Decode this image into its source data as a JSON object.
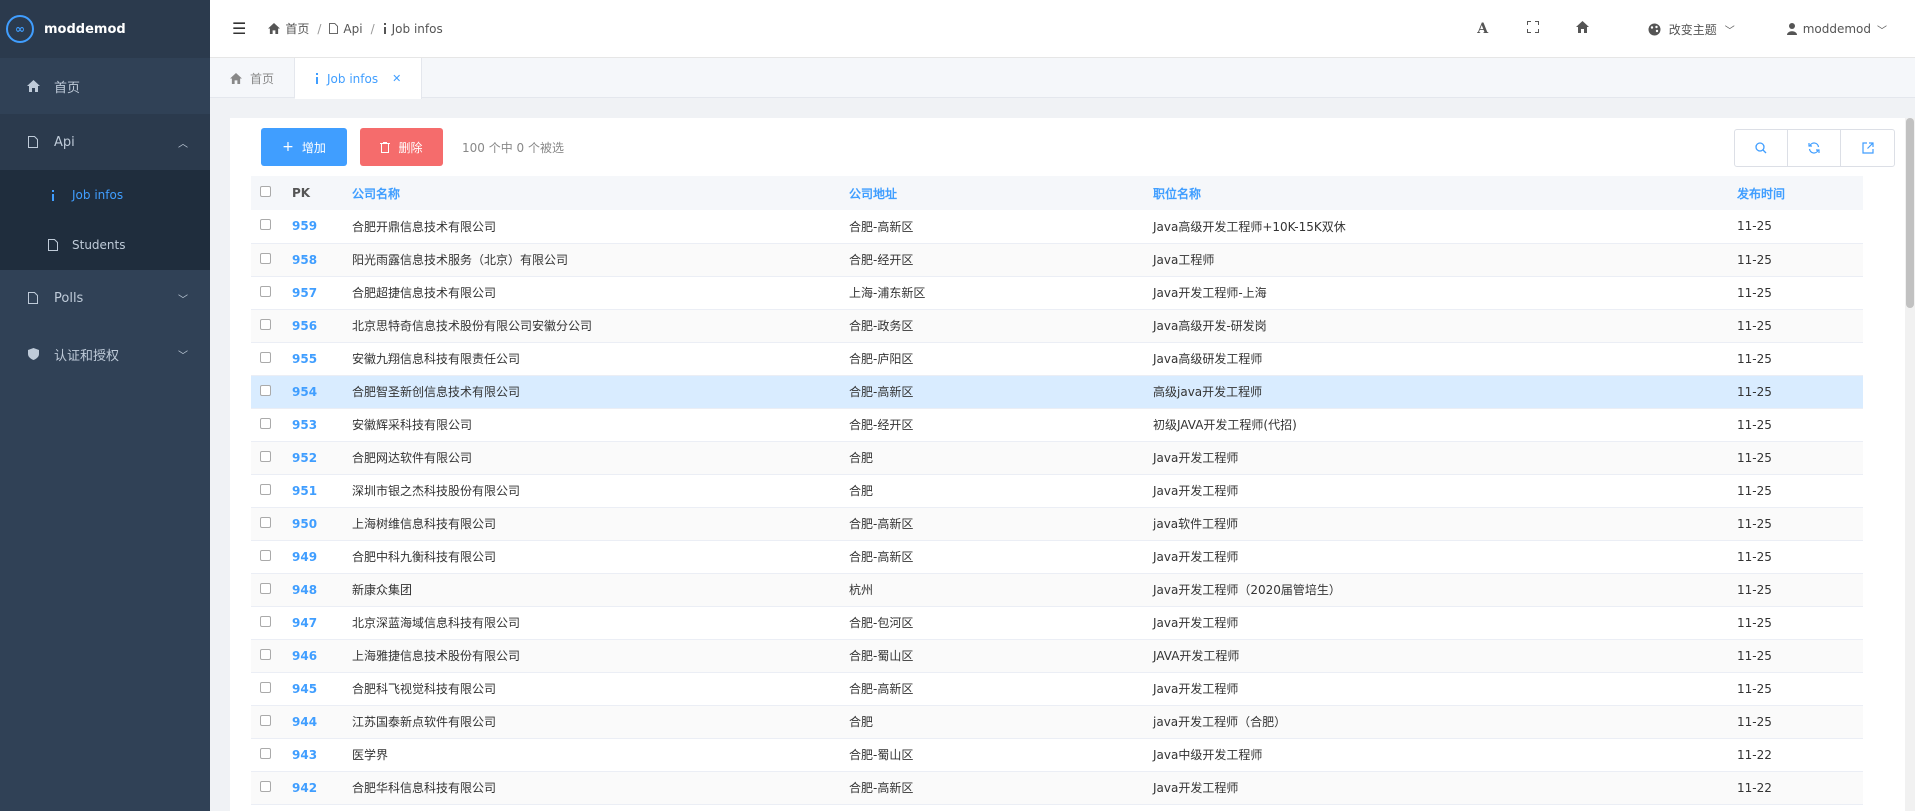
{
  "brand": {
    "name": "moddemod",
    "logo_text": "∞"
  },
  "sidebar": {
    "home": "首页",
    "api": "Api",
    "api_children": [
      "Job infos",
      "Students"
    ],
    "polls": "Polls",
    "auth": "认证和授权"
  },
  "header": {
    "breadcrumb": [
      "首页",
      "Api",
      "Job infos"
    ],
    "theme_label": "改变主题",
    "user_label": "moddemod"
  },
  "tabs": [
    {
      "label": "首页"
    },
    {
      "label": "Job infos"
    }
  ],
  "toolbar": {
    "add_label": "增加",
    "delete_label": "删除",
    "selection_info": "100 个中 0 个被选"
  },
  "table": {
    "headers": [
      "PK",
      "公司名称",
      "公司地址",
      "职位名称",
      "发布时间"
    ],
    "rows": [
      {
        "pk": "959",
        "company": "合肥开鼎信息技术有限公司",
        "address": "合肥-高新区",
        "title": "Java高级开发工程师+10K-15K双休",
        "date": "11-25"
      },
      {
        "pk": "958",
        "company": "阳光雨露信息技术服务（北京）有限公司",
        "address": "合肥-经开区",
        "title": "Java工程师",
        "date": "11-25"
      },
      {
        "pk": "957",
        "company": "合肥超捷信息技术有限公司",
        "address": "上海-浦东新区",
        "title": "Java开发工程师-上海",
        "date": "11-25"
      },
      {
        "pk": "956",
        "company": "北京思特奇信息技术股份有限公司安徽分公司",
        "address": "合肥-政务区",
        "title": "Java高级开发-研发岗",
        "date": "11-25"
      },
      {
        "pk": "955",
        "company": "安徽九翔信息科技有限责任公司",
        "address": "合肥-庐阳区",
        "title": "Java高级研发工程师",
        "date": "11-25"
      },
      {
        "pk": "954",
        "company": "合肥智圣新创信息技术有限公司",
        "address": "合肥-高新区",
        "title": "高级java开发工程师",
        "date": "11-25"
      },
      {
        "pk": "953",
        "company": "安徽辉采科技有限公司",
        "address": "合肥-经开区",
        "title": "初级JAVA开发工程师(代招)",
        "date": "11-25"
      },
      {
        "pk": "952",
        "company": "合肥网达软件有限公司",
        "address": "合肥",
        "title": "Java开发工程师",
        "date": "11-25"
      },
      {
        "pk": "951",
        "company": "深圳市银之杰科技股份有限公司",
        "address": "合肥",
        "title": "Java开发工程师",
        "date": "11-25"
      },
      {
        "pk": "950",
        "company": "上海树维信息科技有限公司",
        "address": "合肥-高新区",
        "title": "java软件工程师",
        "date": "11-25"
      },
      {
        "pk": "949",
        "company": "合肥中科九衡科技有限公司",
        "address": "合肥-高新区",
        "title": "Java开发工程师",
        "date": "11-25"
      },
      {
        "pk": "948",
        "company": "新康众集团",
        "address": "杭州",
        "title": "Java开发工程师（2020届管培生）",
        "date": "11-25"
      },
      {
        "pk": "947",
        "company": "北京深蓝海域信息科技有限公司",
        "address": "合肥-包河区",
        "title": "Java开发工程师",
        "date": "11-25"
      },
      {
        "pk": "946",
        "company": "上海雅捷信息技术股份有限公司",
        "address": "合肥-蜀山区",
        "title": "JAVA开发工程师",
        "date": "11-25"
      },
      {
        "pk": "945",
        "company": "合肥科飞视觉科技有限公司",
        "address": "合肥-高新区",
        "title": "Java开发工程师",
        "date": "11-25"
      },
      {
        "pk": "944",
        "company": "江苏国泰新点软件有限公司",
        "address": "合肥",
        "title": "java开发工程师（合肥）",
        "date": "11-25"
      },
      {
        "pk": "943",
        "company": "医学界",
        "address": "合肥-蜀山区",
        "title": "Java中级开发工程师",
        "date": "11-22"
      },
      {
        "pk": "942",
        "company": "合肥华科信息科技有限公司",
        "address": "合肥-高新区",
        "title": "Java开发工程师",
        "date": "11-22"
      }
    ]
  },
  "colors": {
    "primary": "#409eff",
    "danger": "#f56c6c",
    "sidebar_bg": "#304156",
    "row_highlight": "#d9ecff"
  }
}
